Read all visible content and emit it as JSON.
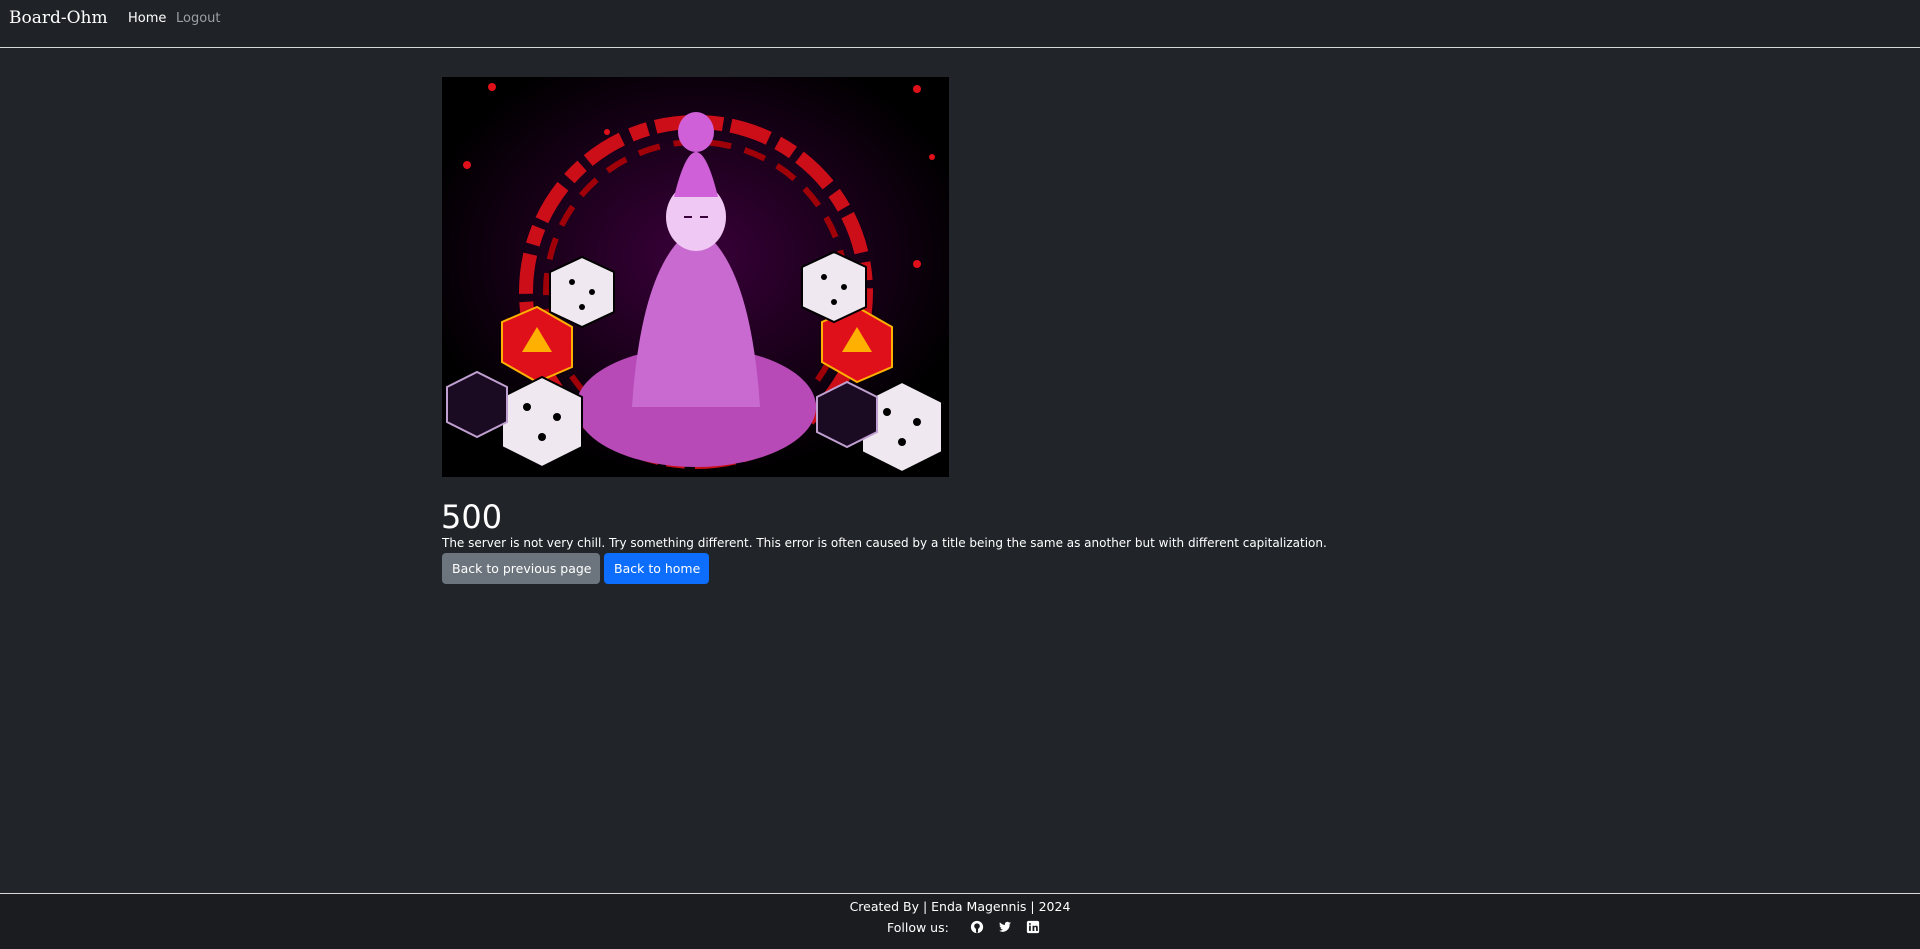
{
  "navbar": {
    "brand": "Board-Ohm",
    "links": [
      {
        "label": "Home",
        "active": true
      },
      {
        "label": "Logout",
        "active": false
      }
    ]
  },
  "error": {
    "code": "500",
    "message": "The server is not very chill. Try something different. This error is often caused by a title being the same as another but with different capitalization.",
    "image": "meditating-figure-with-dice-illustration"
  },
  "actions": {
    "back_label": "Back to previous page",
    "home_label": "Back to home"
  },
  "footer": {
    "credit": "Created By | Enda Magennis | 2024",
    "follow_label": "Follow us:",
    "social": [
      "github-icon",
      "twitter-icon",
      "linkedin-icon"
    ]
  },
  "colors": {
    "background": "#212529",
    "navbar": "#1f2226",
    "footer": "#1a1c1f",
    "secondary_button": "#6c757d",
    "primary_button": "#0d6efd",
    "illustration_accent": "#e600e6",
    "illustration_red": "#e0101a"
  }
}
